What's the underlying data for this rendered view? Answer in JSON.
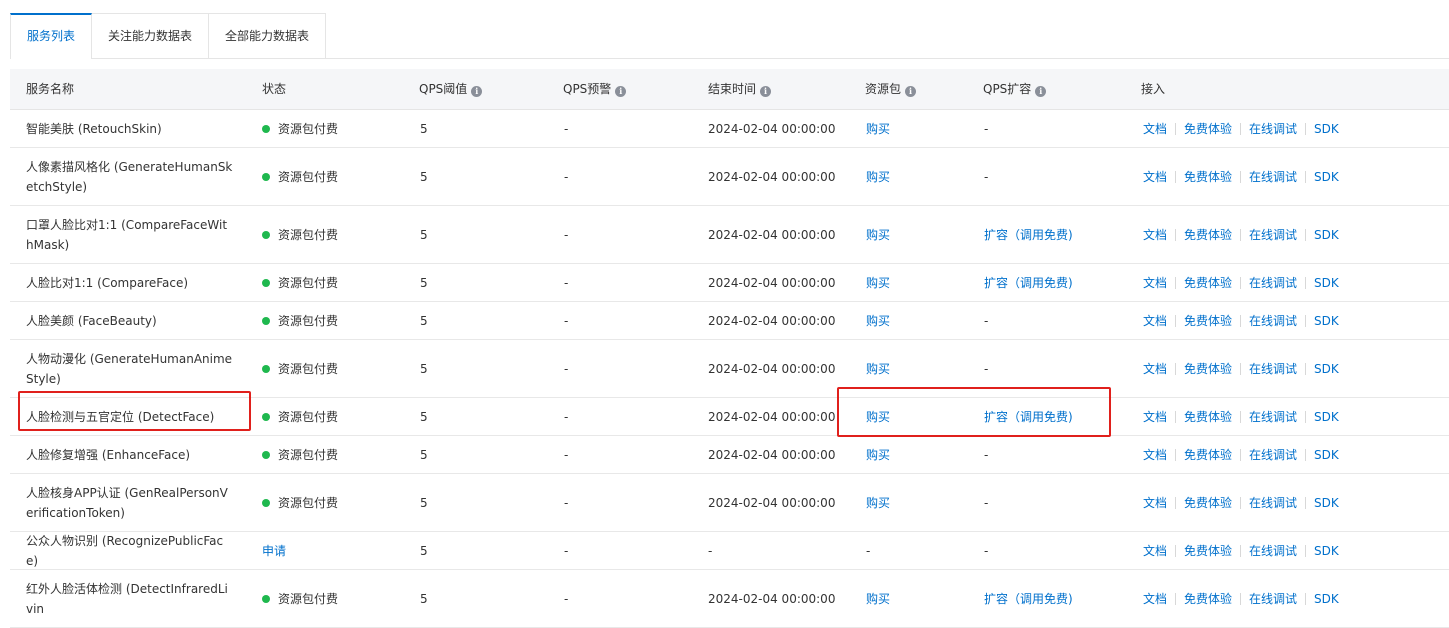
{
  "tabs": [
    {
      "label": "服务列表",
      "active": true
    },
    {
      "label": "关注能力数据表",
      "active": false
    },
    {
      "label": "全部能力数据表",
      "active": false
    }
  ],
  "columns": {
    "name": "服务名称",
    "status": "状态",
    "qps_threshold": "QPS阈值",
    "qps_alert": "QPS预警",
    "end_time": "结束时间",
    "resource_pack": "资源包",
    "qps_expand": "QPS扩容",
    "access": "接入"
  },
  "access_links": {
    "doc": "文档",
    "trial": "免费体验",
    "debug": "在线调试",
    "sdk": "SDK"
  },
  "rows": [
    {
      "name": "智能美肤 (RetouchSkin)",
      "status": "资源包付费",
      "status_type": "dot",
      "qps": "5",
      "alert": "-",
      "end": "2024-02-04 00:00:00",
      "pack": "购买",
      "pack_link": true,
      "expand": "-",
      "expand_link": false
    },
    {
      "name": "人像素描风格化 (GenerateHumanSketchStyle)",
      "status": "资源包付费",
      "status_type": "dot",
      "qps": "5",
      "alert": "-",
      "end": "2024-02-04 00:00:00",
      "pack": "购买",
      "pack_link": true,
      "expand": "-",
      "expand_link": false
    },
    {
      "name": "口罩人脸比对1:1 (CompareFaceWithMask)",
      "status": "资源包付费",
      "status_type": "dot",
      "qps": "5",
      "alert": "-",
      "end": "2024-02-04 00:00:00",
      "pack": "购买",
      "pack_link": true,
      "expand": "扩容（调用免费)",
      "expand_link": true
    },
    {
      "name": "人脸比对1:1 (CompareFace)",
      "status": "资源包付费",
      "status_type": "dot",
      "qps": "5",
      "alert": "-",
      "end": "2024-02-04 00:00:00",
      "pack": "购买",
      "pack_link": true,
      "expand": "扩容（调用免费)",
      "expand_link": true
    },
    {
      "name": "人脸美颜 (FaceBeauty)",
      "status": "资源包付费",
      "status_type": "dot",
      "qps": "5",
      "alert": "-",
      "end": "2024-02-04 00:00:00",
      "pack": "购买",
      "pack_link": true,
      "expand": "-",
      "expand_link": false
    },
    {
      "name": "人物动漫化 (GenerateHumanAnimeStyle)",
      "status": "资源包付费",
      "status_type": "dot",
      "qps": "5",
      "alert": "-",
      "end": "2024-02-04 00:00:00",
      "pack": "购买",
      "pack_link": true,
      "expand": "-",
      "expand_link": false
    },
    {
      "name": "人脸检测与五官定位 (DetectFace)",
      "status": "资源包付费",
      "status_type": "dot",
      "qps": "5",
      "alert": "-",
      "end": "2024-02-04 00:00:00",
      "pack": "购买",
      "pack_link": true,
      "expand": "扩容（调用免费)",
      "expand_link": true
    },
    {
      "name": "人脸修复增强 (EnhanceFace)",
      "status": "资源包付费",
      "status_type": "dot",
      "qps": "5",
      "alert": "-",
      "end": "2024-02-04 00:00:00",
      "pack": "购买",
      "pack_link": true,
      "expand": "-",
      "expand_link": false
    },
    {
      "name": "人脸核身APP认证 (GenRealPersonVerificationToken)",
      "status": "资源包付费",
      "status_type": "dot",
      "qps": "5",
      "alert": "-",
      "end": "2024-02-04 00:00:00",
      "pack": "购买",
      "pack_link": true,
      "expand": "-",
      "expand_link": false
    },
    {
      "name": "公众人物识别 (RecognizePublicFace)",
      "status": "申请",
      "status_type": "link",
      "qps": "5",
      "alert": "-",
      "end": "-",
      "pack": "-",
      "pack_link": false,
      "expand": "-",
      "expand_link": false
    },
    {
      "name": "红外人脸活体检测 (DetectInfraredLivin",
      "status": "资源包付费",
      "status_type": "dot",
      "qps": "5",
      "alert": "-",
      "end": "2024-02-04 00:00:00",
      "pack": "购买",
      "pack_link": true,
      "expand": "扩容（调用免费)",
      "expand_link": true
    }
  ],
  "colors": {
    "accent": "#0070cc",
    "status_green": "#1fb84e",
    "highlight_red": "#e0201c",
    "header_bg": "#f5f6f8"
  }
}
